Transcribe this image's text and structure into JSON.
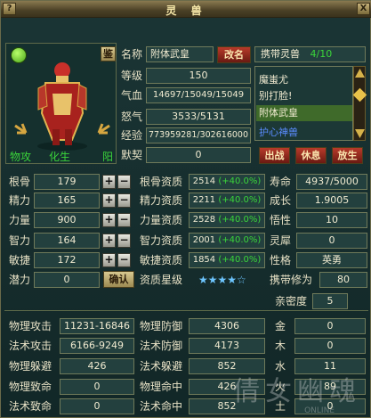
{
  "title": "灵 兽",
  "titlebar": {
    "help": "?",
    "close": "X"
  },
  "portrait": {
    "buttons": {
      "jian": "鉴"
    },
    "labels": [
      "物攻",
      "化生",
      "阳"
    ]
  },
  "info": {
    "name_label": "名称",
    "name_value": "附体武皇",
    "rename_btn": "改名",
    "level_label": "等级",
    "level_value": "150",
    "hp_label": "气血",
    "hp_value": "14697/15049/15049",
    "rage_label": "怒气",
    "rage_value": "3533/5131",
    "exp_label": "经验",
    "exp_value": "773959281/302616000",
    "tacit_label": "默契",
    "tacit_value": "0"
  },
  "carry": {
    "label": "携带灵兽",
    "count": "4/10",
    "list": [
      "魔蚩尤",
      "别打脸!",
      "附体武皇",
      "护心神兽"
    ],
    "buttons": {
      "fight": "出战",
      "rest": "休息",
      "release": "放生"
    }
  },
  "attributes": [
    {
      "label": "根骨",
      "value": "179"
    },
    {
      "label": "精力",
      "value": "165"
    },
    {
      "label": "力量",
      "value": "900"
    },
    {
      "label": "智力",
      "value": "164"
    },
    {
      "label": "敏捷",
      "value": "172"
    }
  ],
  "potential": {
    "label": "潜力",
    "value": "0",
    "confirm": "确认"
  },
  "aptitudes": [
    {
      "label": "根骨资质",
      "value": "2514",
      "bonus": "(+40.0%)"
    },
    {
      "label": "精力资质",
      "value": "2211",
      "bonus": "(+40.0%)"
    },
    {
      "label": "力量资质",
      "value": "2528",
      "bonus": "(+40.0%)"
    },
    {
      "label": "智力资质",
      "value": "2001",
      "bonus": "(+40.0%)"
    },
    {
      "label": "敏捷资质",
      "value": "1854",
      "bonus": "(+40.0%)"
    }
  ],
  "aptitude_stars": {
    "label": "资质星级",
    "stars": "★★★★☆"
  },
  "right_stats": [
    {
      "label": "寿命",
      "value": "4937/5000"
    },
    {
      "label": "成长",
      "value": "1.9005"
    },
    {
      "label": "悟性",
      "value": "10"
    },
    {
      "label": "灵犀",
      "value": "0"
    },
    {
      "label": "性格",
      "value": "英勇"
    },
    {
      "label": "携带修为",
      "value": "80"
    },
    {
      "label": "亲密度",
      "value": "5"
    }
  ],
  "combat": [
    {
      "label": "物理攻击",
      "value": "11231-16846"
    },
    {
      "label": "法术攻击",
      "value": "6166-9249"
    },
    {
      "label": "物理躲避",
      "value": "426"
    },
    {
      "label": "物理致命",
      "value": "0"
    },
    {
      "label": "法术致命",
      "value": "0"
    }
  ],
  "defense": [
    {
      "label": "物理防御",
      "value": "4306"
    },
    {
      "label": "法术防御",
      "value": "4173"
    },
    {
      "label": "法术躲避",
      "value": "852"
    },
    {
      "label": "物理命中",
      "value": "426"
    },
    {
      "label": "法术命中",
      "value": "852"
    }
  ],
  "elements": [
    {
      "label": "金",
      "value": "0"
    },
    {
      "label": "木",
      "value": "0"
    },
    {
      "label": "水",
      "value": "11"
    },
    {
      "label": "火",
      "value": "89"
    },
    {
      "label": "土",
      "value": "0"
    }
  ],
  "watermark": {
    "text": "倩女幽魂",
    "sub": "ONLINE"
  }
}
